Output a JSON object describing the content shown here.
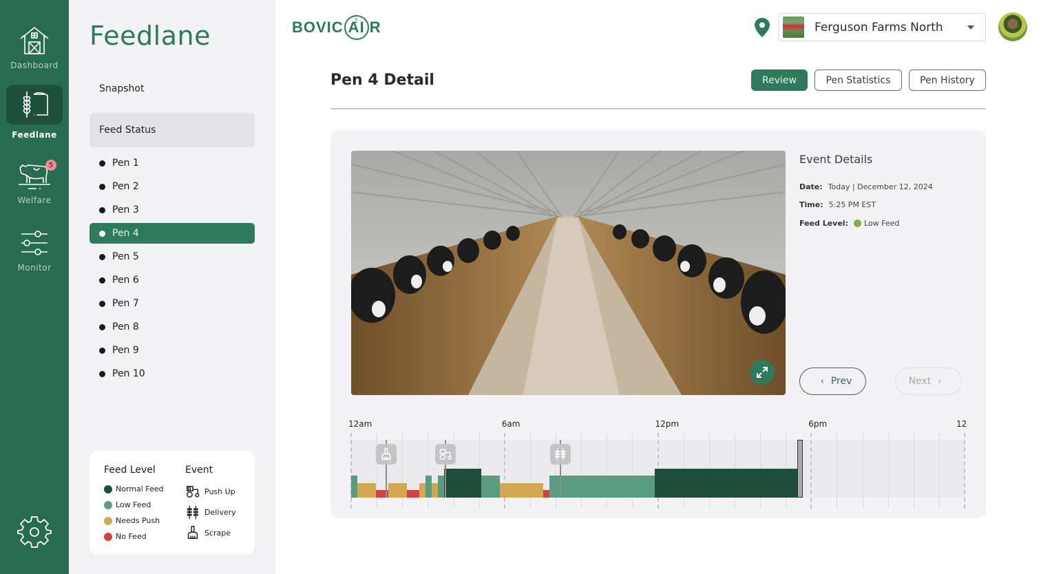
{
  "rail": {
    "items": [
      {
        "label": "Dashboard",
        "icon": "barn-icon",
        "active": false
      },
      {
        "label": "Feedlane",
        "icon": "feed-icon",
        "active": true
      },
      {
        "label": "Welfare",
        "icon": "cow-icon",
        "active": false,
        "badge": "5"
      },
      {
        "label": "Monitor",
        "icon": "sliders-icon",
        "active": false
      }
    ],
    "settings_icon": "gear-icon"
  },
  "subnav": {
    "title": "Feedlane",
    "links": [
      {
        "label": "Snapshot",
        "selected": false
      },
      {
        "label": "Feed Status",
        "selected": true
      }
    ],
    "pens": [
      "Pen 1",
      "Pen 2",
      "Pen 3",
      "Pen 4",
      "Pen 5",
      "Pen 6",
      "Pen 7",
      "Pen 8",
      "Pen 9",
      "Pen 10"
    ],
    "active_pen": "Pen 4"
  },
  "legend": {
    "feed_title": "Feed Level",
    "feed_levels": [
      {
        "key": "normal",
        "label": "Normal Feed",
        "color": "#1e4d3b"
      },
      {
        "key": "low",
        "label": "Low Feed",
        "color": "#5a9c82"
      },
      {
        "key": "push",
        "label": "Needs Push",
        "color": "#d4a853"
      },
      {
        "key": "none",
        "label": "No Feed",
        "color": "#d34141"
      }
    ],
    "event_title": "Event",
    "events": [
      {
        "key": "pushup",
        "label": "Push Up",
        "icon": "tractor-icon"
      },
      {
        "key": "delivery",
        "label": "Delivery",
        "icon": "wheat-icon"
      },
      {
        "key": "scrape",
        "label": "Scrape",
        "icon": "broom-icon"
      }
    ]
  },
  "header": {
    "logo": {
      "part1": "BOVIC",
      "ring_letter": "A",
      "ring_sup": "2",
      "part2": "I",
      "part3": "R"
    },
    "location_icon": "map-pin-icon",
    "farm": "Ferguson Farms North"
  },
  "page": {
    "title": "Pen 4 Detail",
    "tabs": [
      {
        "label": "Review",
        "primary": true
      },
      {
        "label": "Pen Statistics",
        "primary": false
      },
      {
        "label": "Pen History",
        "primary": false
      }
    ]
  },
  "event": {
    "title": "Event Details",
    "date_label": "Date:",
    "date_value": "Today | December 12, 2024",
    "time_label": "Time:",
    "time_value": "5:25 PM EST",
    "level_label": "Feed Level:",
    "level_value": "Low Feed",
    "level_color": "#7cb342",
    "prev_label": "Prev",
    "next_label": "Next",
    "next_disabled": true
  },
  "chart_data": {
    "type": "timeline",
    "x_unit": "hours since midnight",
    "xlim": [
      0,
      24
    ],
    "tick_labels": [
      {
        "h": 0,
        "label": "12am"
      },
      {
        "h": 6,
        "label": "6am"
      },
      {
        "h": 12,
        "label": "12pm"
      },
      {
        "h": 18,
        "label": "6pm"
      },
      {
        "h": 24,
        "label": "12"
      }
    ],
    "segments": [
      {
        "start": 0.0,
        "end": 0.25,
        "level": "low"
      },
      {
        "start": 0.25,
        "end": 0.97,
        "level": "push"
      },
      {
        "start": 0.97,
        "end": 1.45,
        "level": "none"
      },
      {
        "start": 1.45,
        "end": 2.18,
        "level": "push"
      },
      {
        "start": 2.18,
        "end": 2.67,
        "level": "none"
      },
      {
        "start": 2.67,
        "end": 2.91,
        "level": "push"
      },
      {
        "start": 2.91,
        "end": 3.15,
        "level": "low"
      },
      {
        "start": 3.15,
        "end": 3.4,
        "level": "push"
      },
      {
        "start": 3.4,
        "end": 3.64,
        "level": "low"
      },
      {
        "start": 3.64,
        "end": 5.09,
        "level": "normal"
      },
      {
        "start": 5.09,
        "end": 5.82,
        "level": "low"
      },
      {
        "start": 5.82,
        "end": 7.52,
        "level": "push"
      },
      {
        "start": 7.52,
        "end": 7.76,
        "level": "none"
      },
      {
        "start": 7.76,
        "end": 11.87,
        "level": "low"
      },
      {
        "start": 11.87,
        "end": 17.5,
        "level": "normal"
      }
    ],
    "events": [
      {
        "h": 1.37,
        "type": "scrape"
      },
      {
        "h": 3.69,
        "type": "pushup"
      },
      {
        "h": 8.2,
        "type": "delivery"
      }
    ],
    "current_h": 17.5
  }
}
